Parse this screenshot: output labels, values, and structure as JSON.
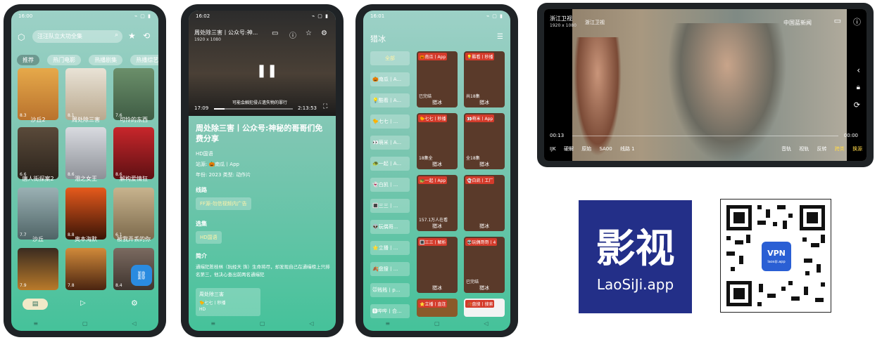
{
  "phone1": {
    "status_time": "16:00",
    "search_placeholder": "汪汪队立大功全集",
    "categories": [
      "推荐",
      "热门电影",
      "热播剧集",
      "热播综艺"
    ],
    "items": [
      {
        "title": "沙丘2",
        "rating": "8.3"
      },
      {
        "title": "周处除三害",
        "rating": "8.1"
      },
      {
        "title": "可怜的东西",
        "rating": "7.6"
      },
      {
        "title": "唐人街探案2",
        "rating": "6.6"
      },
      {
        "title": "泪之女王",
        "rating": "8.6"
      },
      {
        "title": "解构爱情狂",
        "rating": "8.6"
      },
      {
        "title": "沙丘",
        "rating": "7.7"
      },
      {
        "title": "奥本海默",
        "rating": "8.8"
      },
      {
        "title": "被我弄丢的你",
        "rating": "6.1"
      },
      {
        "title": "",
        "rating": "7.9"
      },
      {
        "title": "",
        "rating": "7.8"
      },
      {
        "title": "",
        "rating": "8.4"
      }
    ]
  },
  "phone2": {
    "status_time": "16:02",
    "player_title": "周处除三害丨公众号:神...",
    "resolution": "1920 x 1080",
    "current_time": "17:09",
    "duration": "2:13:53",
    "subtitle_line": "可能会触犯侵占遗失物的罪行",
    "progress": 0.13,
    "title": "周处除三害丨公众号:神秘的哥哥们免费分享",
    "quality": "HD国语",
    "source": "站源: 🎃南瓜丨App",
    "year_type": "年份: 2023  类型: 动作片",
    "route_label": "线路",
    "route_value": "FF源-勿信视频内广告",
    "episode_label": "选集",
    "episode_value": "HD国语",
    "intro_label": "简介",
    "intro_text": "通缉犯陈桂林（阮经天 饰）生命将尽，却发现自己在通缉榜上只排名第三，他决心查出前两名通缉犯",
    "card_title": "周处除三害",
    "card_line2": "🐤七七丨秒播",
    "card_line3": "HD"
  },
  "phone3": {
    "status_time": "16:01",
    "search_text": "猎冰",
    "sources": [
      "全部",
      "🎃南瓜丨A...",
      "💡酷看丨A...",
      "🐤七七丨...",
      "👀萌米丨A...",
      "🐢一起丨A...",
      "👻白凯丨...",
      "🔳三三丨...",
      "👽玩偶哥...",
      "⭐立播丨...",
      "🍂盘搜丨...",
      "🐭贱贱丨p...",
      "🅱哔哔丨合..."
    ],
    "tiles": [
      {
        "tag": "🎃南瓜丨App",
        "mid": "已完结",
        "bottom": "猎冰",
        "ep": "2"
      },
      {
        "tag": "💡酷看丨秒播",
        "mid": "共18集",
        "bottom": "猎冰",
        "ep": "2"
      },
      {
        "tag": "🐤七七丨秒播",
        "mid": "18集全",
        "bottom": "猎冰",
        "ep": "2"
      },
      {
        "tag": "👀萌米丨App",
        "mid": "全18集",
        "bottom": "猎冰",
        "ep": "2"
      },
      {
        "tag": "🐢一起丨App",
        "mid": "157.1万人在看",
        "bottom": "猎冰",
        "ep": ""
      },
      {
        "tag": "👻白凯丨工厂",
        "mid": "",
        "bottom": "猎冰",
        "ep": "2"
      },
      {
        "tag": "🔳三三丨解析",
        "mid": "",
        "bottom": "猎冰",
        "ep": "2"
      },
      {
        "tag": "👽玩偶哥哥丨4",
        "mid": "已完结",
        "bottom": "猎冰",
        "ep": "2"
      },
      {
        "tag": "⭐立播丨直连",
        "mid": "",
        "bottom": "",
        "ep": ""
      },
      {
        "tag": "🍂盘搜丨搜索",
        "mid": "",
        "bottom": "",
        "ep": ""
      }
    ]
  },
  "tv": {
    "channel": "浙江卫视",
    "resolution": "1920 x 1080",
    "logo_left": "浙江卫视",
    "logo_right": "中国蓝新闻",
    "time_left": "00:13",
    "time_right": "00:00",
    "controls_left": [
      "IJK",
      "硬解",
      "原始",
      "SA00",
      "线路 1"
    ],
    "controls_right": [
      "音轨",
      "视轨",
      "反转",
      "跨类",
      "换源"
    ]
  },
  "brand": {
    "title": "影视",
    "sub": "LaoSiJi.app",
    "vpn": "VPN",
    "vpn_sub": "laosiji.app"
  }
}
